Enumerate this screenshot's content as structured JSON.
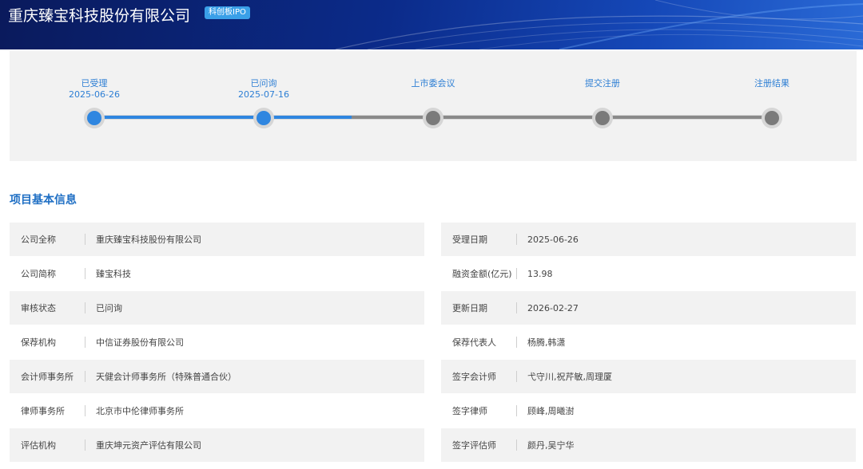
{
  "header": {
    "company_name": "重庆臻宝科技股份有限公司",
    "board_badge": "科创板IPO"
  },
  "progress": {
    "steps": [
      {
        "label": "已受理",
        "date": "2025-06-26",
        "done": true
      },
      {
        "label": "已问询",
        "date": "2025-07-16",
        "done": true
      },
      {
        "label": "上市委会议",
        "date": "",
        "done": false
      },
      {
        "label": "提交注册",
        "date": "",
        "done": false
      },
      {
        "label": "注册结果",
        "date": "",
        "done": false
      }
    ]
  },
  "section": {
    "title": "项目基本信息"
  },
  "info": {
    "left": [
      {
        "label": "公司全称",
        "value": "重庆臻宝科技股份有限公司"
      },
      {
        "label": "公司简称",
        "value": "臻宝科技"
      },
      {
        "label": "审核状态",
        "value": "已问询"
      },
      {
        "label": "保荐机构",
        "value": "中信证券股份有限公司"
      },
      {
        "label": "会计师事务所",
        "value": "天健会计师事务所（特殊普通合伙）"
      },
      {
        "label": "律师事务所",
        "value": "北京市中伦律师事务所"
      },
      {
        "label": "评估机构",
        "value": "重庆坤元资产评估有限公司"
      }
    ],
    "right": [
      {
        "label": "受理日期",
        "value": "2025-06-26"
      },
      {
        "label": "融资金额(亿元)",
        "value": "13.98"
      },
      {
        "label": "更新日期",
        "value": "2026-02-27"
      },
      {
        "label": "保荐代表人",
        "value": "杨腾,韩潇"
      },
      {
        "label": "签字会计师",
        "value": "弋守川,祝芹敏,周理厦"
      },
      {
        "label": "签字律师",
        "value": "顾峰,周曦澍"
      },
      {
        "label": "签字评估师",
        "value": "颜丹,吴宁华"
      }
    ]
  },
  "colors": {
    "accent": "#2f86e0",
    "title_blue": "#1f6fc4",
    "row_shade": "#f2f2f2"
  }
}
